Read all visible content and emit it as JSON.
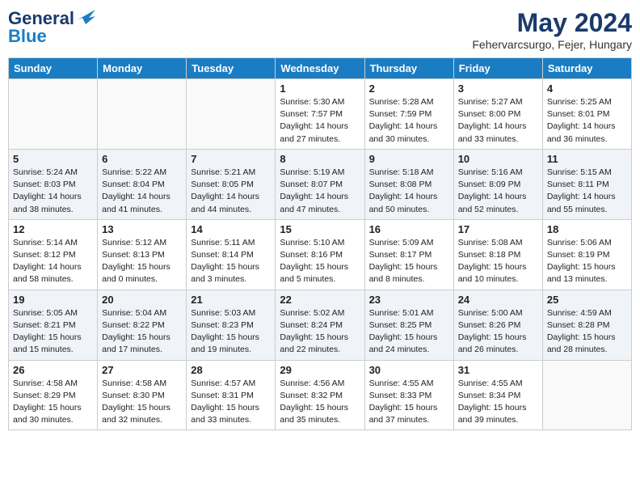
{
  "header": {
    "logo_line1": "General",
    "logo_line2": "Blue",
    "month": "May 2024",
    "location": "Fehervarcsurgo, Fejer, Hungary"
  },
  "weekdays": [
    "Sunday",
    "Monday",
    "Tuesday",
    "Wednesday",
    "Thursday",
    "Friday",
    "Saturday"
  ],
  "weeks": [
    [
      {
        "day": "",
        "detail": ""
      },
      {
        "day": "",
        "detail": ""
      },
      {
        "day": "",
        "detail": ""
      },
      {
        "day": "1",
        "detail": "Sunrise: 5:30 AM\nSunset: 7:57 PM\nDaylight: 14 hours\nand 27 minutes."
      },
      {
        "day": "2",
        "detail": "Sunrise: 5:28 AM\nSunset: 7:59 PM\nDaylight: 14 hours\nand 30 minutes."
      },
      {
        "day": "3",
        "detail": "Sunrise: 5:27 AM\nSunset: 8:00 PM\nDaylight: 14 hours\nand 33 minutes."
      },
      {
        "day": "4",
        "detail": "Sunrise: 5:25 AM\nSunset: 8:01 PM\nDaylight: 14 hours\nand 36 minutes."
      }
    ],
    [
      {
        "day": "5",
        "detail": "Sunrise: 5:24 AM\nSunset: 8:03 PM\nDaylight: 14 hours\nand 38 minutes."
      },
      {
        "day": "6",
        "detail": "Sunrise: 5:22 AM\nSunset: 8:04 PM\nDaylight: 14 hours\nand 41 minutes."
      },
      {
        "day": "7",
        "detail": "Sunrise: 5:21 AM\nSunset: 8:05 PM\nDaylight: 14 hours\nand 44 minutes."
      },
      {
        "day": "8",
        "detail": "Sunrise: 5:19 AM\nSunset: 8:07 PM\nDaylight: 14 hours\nand 47 minutes."
      },
      {
        "day": "9",
        "detail": "Sunrise: 5:18 AM\nSunset: 8:08 PM\nDaylight: 14 hours\nand 50 minutes."
      },
      {
        "day": "10",
        "detail": "Sunrise: 5:16 AM\nSunset: 8:09 PM\nDaylight: 14 hours\nand 52 minutes."
      },
      {
        "day": "11",
        "detail": "Sunrise: 5:15 AM\nSunset: 8:11 PM\nDaylight: 14 hours\nand 55 minutes."
      }
    ],
    [
      {
        "day": "12",
        "detail": "Sunrise: 5:14 AM\nSunset: 8:12 PM\nDaylight: 14 hours\nand 58 minutes."
      },
      {
        "day": "13",
        "detail": "Sunrise: 5:12 AM\nSunset: 8:13 PM\nDaylight: 15 hours\nand 0 minutes."
      },
      {
        "day": "14",
        "detail": "Sunrise: 5:11 AM\nSunset: 8:14 PM\nDaylight: 15 hours\nand 3 minutes."
      },
      {
        "day": "15",
        "detail": "Sunrise: 5:10 AM\nSunset: 8:16 PM\nDaylight: 15 hours\nand 5 minutes."
      },
      {
        "day": "16",
        "detail": "Sunrise: 5:09 AM\nSunset: 8:17 PM\nDaylight: 15 hours\nand 8 minutes."
      },
      {
        "day": "17",
        "detail": "Sunrise: 5:08 AM\nSunset: 8:18 PM\nDaylight: 15 hours\nand 10 minutes."
      },
      {
        "day": "18",
        "detail": "Sunrise: 5:06 AM\nSunset: 8:19 PM\nDaylight: 15 hours\nand 13 minutes."
      }
    ],
    [
      {
        "day": "19",
        "detail": "Sunrise: 5:05 AM\nSunset: 8:21 PM\nDaylight: 15 hours\nand 15 minutes."
      },
      {
        "day": "20",
        "detail": "Sunrise: 5:04 AM\nSunset: 8:22 PM\nDaylight: 15 hours\nand 17 minutes."
      },
      {
        "day": "21",
        "detail": "Sunrise: 5:03 AM\nSunset: 8:23 PM\nDaylight: 15 hours\nand 19 minutes."
      },
      {
        "day": "22",
        "detail": "Sunrise: 5:02 AM\nSunset: 8:24 PM\nDaylight: 15 hours\nand 22 minutes."
      },
      {
        "day": "23",
        "detail": "Sunrise: 5:01 AM\nSunset: 8:25 PM\nDaylight: 15 hours\nand 24 minutes."
      },
      {
        "day": "24",
        "detail": "Sunrise: 5:00 AM\nSunset: 8:26 PM\nDaylight: 15 hours\nand 26 minutes."
      },
      {
        "day": "25",
        "detail": "Sunrise: 4:59 AM\nSunset: 8:28 PM\nDaylight: 15 hours\nand 28 minutes."
      }
    ],
    [
      {
        "day": "26",
        "detail": "Sunrise: 4:58 AM\nSunset: 8:29 PM\nDaylight: 15 hours\nand 30 minutes."
      },
      {
        "day": "27",
        "detail": "Sunrise: 4:58 AM\nSunset: 8:30 PM\nDaylight: 15 hours\nand 32 minutes."
      },
      {
        "day": "28",
        "detail": "Sunrise: 4:57 AM\nSunset: 8:31 PM\nDaylight: 15 hours\nand 33 minutes."
      },
      {
        "day": "29",
        "detail": "Sunrise: 4:56 AM\nSunset: 8:32 PM\nDaylight: 15 hours\nand 35 minutes."
      },
      {
        "day": "30",
        "detail": "Sunrise: 4:55 AM\nSunset: 8:33 PM\nDaylight: 15 hours\nand 37 minutes."
      },
      {
        "day": "31",
        "detail": "Sunrise: 4:55 AM\nSunset: 8:34 PM\nDaylight: 15 hours\nand 39 minutes."
      },
      {
        "day": "",
        "detail": ""
      }
    ]
  ]
}
